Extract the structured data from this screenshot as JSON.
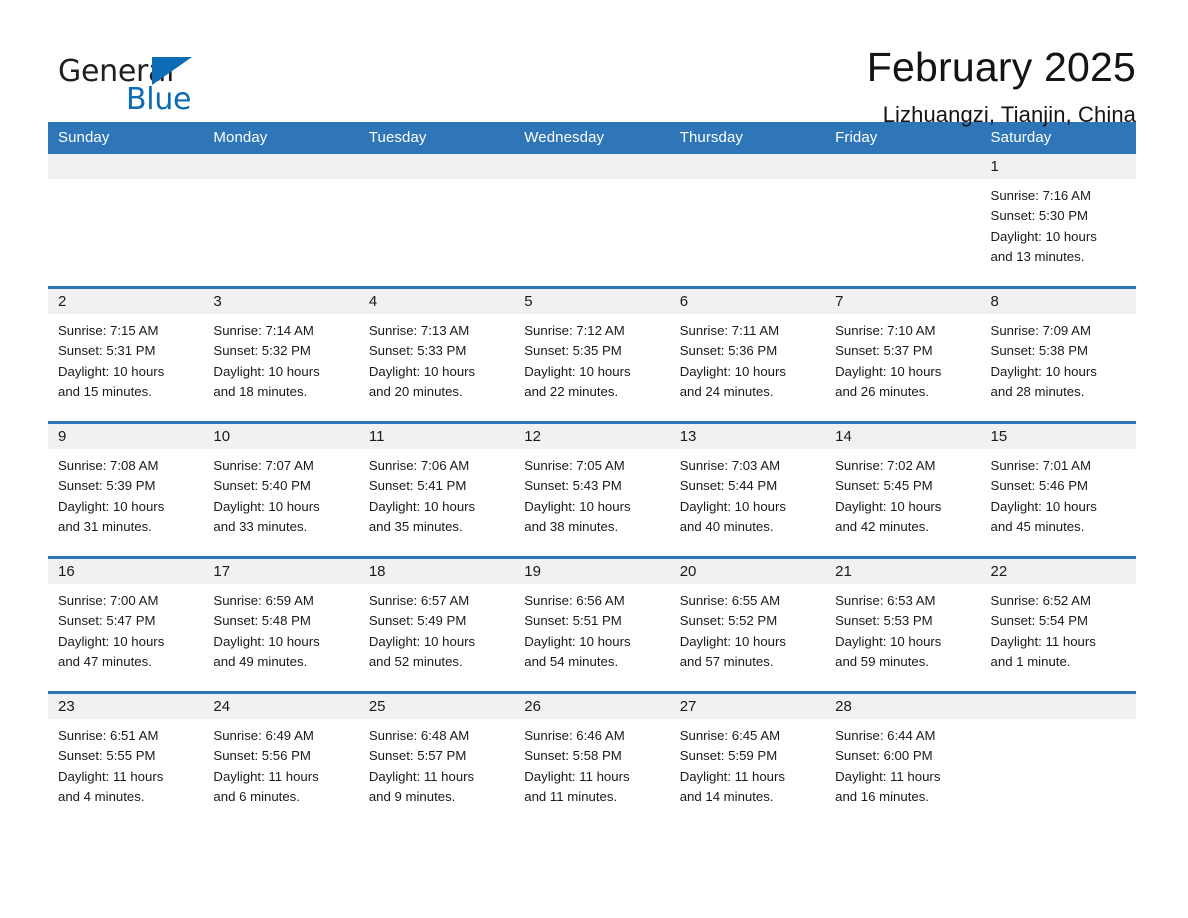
{
  "logo": {
    "word_one": "General",
    "word_two": "Blue",
    "triangle_color": "#0c6cb5"
  },
  "header": {
    "month_title": "February 2025",
    "location": "Lizhuangzi, Tianjin, China"
  },
  "theme": {
    "header_blue": "#2f76b8",
    "daynum_gray": "#f1f1f1",
    "text": "#1a1a1a"
  },
  "calendar": {
    "weekday_headers": [
      "Sunday",
      "Monday",
      "Tuesday",
      "Wednesday",
      "Thursday",
      "Friday",
      "Saturday"
    ],
    "labels": {
      "sunrise": "Sunrise:",
      "sunset": "Sunset:",
      "daylight": "Daylight:"
    },
    "weeks": [
      [
        {
          "day": "",
          "sunrise": "",
          "sunset": "",
          "daylight_line1": "",
          "daylight_line2": "",
          "empty": true
        },
        {
          "day": "",
          "sunrise": "",
          "sunset": "",
          "daylight_line1": "",
          "daylight_line2": "",
          "empty": true
        },
        {
          "day": "",
          "sunrise": "",
          "sunset": "",
          "daylight_line1": "",
          "daylight_line2": "",
          "empty": true
        },
        {
          "day": "",
          "sunrise": "",
          "sunset": "",
          "daylight_line1": "",
          "daylight_line2": "",
          "empty": true
        },
        {
          "day": "",
          "sunrise": "",
          "sunset": "",
          "daylight_line1": "",
          "daylight_line2": "",
          "empty": true
        },
        {
          "day": "",
          "sunrise": "",
          "sunset": "",
          "daylight_line1": "",
          "daylight_line2": "",
          "empty": true
        },
        {
          "day": "1",
          "sunrise": "Sunrise: 7:16 AM",
          "sunset": "Sunset: 5:30 PM",
          "daylight_line1": "Daylight: 10 hours",
          "daylight_line2": "and 13 minutes.",
          "empty": false
        }
      ],
      [
        {
          "day": "2",
          "sunrise": "Sunrise: 7:15 AM",
          "sunset": "Sunset: 5:31 PM",
          "daylight_line1": "Daylight: 10 hours",
          "daylight_line2": "and 15 minutes.",
          "empty": false
        },
        {
          "day": "3",
          "sunrise": "Sunrise: 7:14 AM",
          "sunset": "Sunset: 5:32 PM",
          "daylight_line1": "Daylight: 10 hours",
          "daylight_line2": "and 18 minutes.",
          "empty": false
        },
        {
          "day": "4",
          "sunrise": "Sunrise: 7:13 AM",
          "sunset": "Sunset: 5:33 PM",
          "daylight_line1": "Daylight: 10 hours",
          "daylight_line2": "and 20 minutes.",
          "empty": false
        },
        {
          "day": "5",
          "sunrise": "Sunrise: 7:12 AM",
          "sunset": "Sunset: 5:35 PM",
          "daylight_line1": "Daylight: 10 hours",
          "daylight_line2": "and 22 minutes.",
          "empty": false
        },
        {
          "day": "6",
          "sunrise": "Sunrise: 7:11 AM",
          "sunset": "Sunset: 5:36 PM",
          "daylight_line1": "Daylight: 10 hours",
          "daylight_line2": "and 24 minutes.",
          "empty": false
        },
        {
          "day": "7",
          "sunrise": "Sunrise: 7:10 AM",
          "sunset": "Sunset: 5:37 PM",
          "daylight_line1": "Daylight: 10 hours",
          "daylight_line2": "and 26 minutes.",
          "empty": false
        },
        {
          "day": "8",
          "sunrise": "Sunrise: 7:09 AM",
          "sunset": "Sunset: 5:38 PM",
          "daylight_line1": "Daylight: 10 hours",
          "daylight_line2": "and 28 minutes.",
          "empty": false
        }
      ],
      [
        {
          "day": "9",
          "sunrise": "Sunrise: 7:08 AM",
          "sunset": "Sunset: 5:39 PM",
          "daylight_line1": "Daylight: 10 hours",
          "daylight_line2": "and 31 minutes.",
          "empty": false
        },
        {
          "day": "10",
          "sunrise": "Sunrise: 7:07 AM",
          "sunset": "Sunset: 5:40 PM",
          "daylight_line1": "Daylight: 10 hours",
          "daylight_line2": "and 33 minutes.",
          "empty": false
        },
        {
          "day": "11",
          "sunrise": "Sunrise: 7:06 AM",
          "sunset": "Sunset: 5:41 PM",
          "daylight_line1": "Daylight: 10 hours",
          "daylight_line2": "and 35 minutes.",
          "empty": false
        },
        {
          "day": "12",
          "sunrise": "Sunrise: 7:05 AM",
          "sunset": "Sunset: 5:43 PM",
          "daylight_line1": "Daylight: 10 hours",
          "daylight_line2": "and 38 minutes.",
          "empty": false
        },
        {
          "day": "13",
          "sunrise": "Sunrise: 7:03 AM",
          "sunset": "Sunset: 5:44 PM",
          "daylight_line1": "Daylight: 10 hours",
          "daylight_line2": "and 40 minutes.",
          "empty": false
        },
        {
          "day": "14",
          "sunrise": "Sunrise: 7:02 AM",
          "sunset": "Sunset: 5:45 PM",
          "daylight_line1": "Daylight: 10 hours",
          "daylight_line2": "and 42 minutes.",
          "empty": false
        },
        {
          "day": "15",
          "sunrise": "Sunrise: 7:01 AM",
          "sunset": "Sunset: 5:46 PM",
          "daylight_line1": "Daylight: 10 hours",
          "daylight_line2": "and 45 minutes.",
          "empty": false
        }
      ],
      [
        {
          "day": "16",
          "sunrise": "Sunrise: 7:00 AM",
          "sunset": "Sunset: 5:47 PM",
          "daylight_line1": "Daylight: 10 hours",
          "daylight_line2": "and 47 minutes.",
          "empty": false
        },
        {
          "day": "17",
          "sunrise": "Sunrise: 6:59 AM",
          "sunset": "Sunset: 5:48 PM",
          "daylight_line1": "Daylight: 10 hours",
          "daylight_line2": "and 49 minutes.",
          "empty": false
        },
        {
          "day": "18",
          "sunrise": "Sunrise: 6:57 AM",
          "sunset": "Sunset: 5:49 PM",
          "daylight_line1": "Daylight: 10 hours",
          "daylight_line2": "and 52 minutes.",
          "empty": false
        },
        {
          "day": "19",
          "sunrise": "Sunrise: 6:56 AM",
          "sunset": "Sunset: 5:51 PM",
          "daylight_line1": "Daylight: 10 hours",
          "daylight_line2": "and 54 minutes.",
          "empty": false
        },
        {
          "day": "20",
          "sunrise": "Sunrise: 6:55 AM",
          "sunset": "Sunset: 5:52 PM",
          "daylight_line1": "Daylight: 10 hours",
          "daylight_line2": "and 57 minutes.",
          "empty": false
        },
        {
          "day": "21",
          "sunrise": "Sunrise: 6:53 AM",
          "sunset": "Sunset: 5:53 PM",
          "daylight_line1": "Daylight: 10 hours",
          "daylight_line2": "and 59 minutes.",
          "empty": false
        },
        {
          "day": "22",
          "sunrise": "Sunrise: 6:52 AM",
          "sunset": "Sunset: 5:54 PM",
          "daylight_line1": "Daylight: 11 hours",
          "daylight_line2": "and 1 minute.",
          "empty": false
        }
      ],
      [
        {
          "day": "23",
          "sunrise": "Sunrise: 6:51 AM",
          "sunset": "Sunset: 5:55 PM",
          "daylight_line1": "Daylight: 11 hours",
          "daylight_line2": "and 4 minutes.",
          "empty": false
        },
        {
          "day": "24",
          "sunrise": "Sunrise: 6:49 AM",
          "sunset": "Sunset: 5:56 PM",
          "daylight_line1": "Daylight: 11 hours",
          "daylight_line2": "and 6 minutes.",
          "empty": false
        },
        {
          "day": "25",
          "sunrise": "Sunrise: 6:48 AM",
          "sunset": "Sunset: 5:57 PM",
          "daylight_line1": "Daylight: 11 hours",
          "daylight_line2": "and 9 minutes.",
          "empty": false
        },
        {
          "day": "26",
          "sunrise": "Sunrise: 6:46 AM",
          "sunset": "Sunset: 5:58 PM",
          "daylight_line1": "Daylight: 11 hours",
          "daylight_line2": "and 11 minutes.",
          "empty": false
        },
        {
          "day": "27",
          "sunrise": "Sunrise: 6:45 AM",
          "sunset": "Sunset: 5:59 PM",
          "daylight_line1": "Daylight: 11 hours",
          "daylight_line2": "and 14 minutes.",
          "empty": false
        },
        {
          "day": "28",
          "sunrise": "Sunrise: 6:44 AM",
          "sunset": "Sunset: 6:00 PM",
          "daylight_line1": "Daylight: 11 hours",
          "daylight_line2": "and 16 minutes.",
          "empty": false
        },
        {
          "day": "",
          "sunrise": "",
          "sunset": "",
          "daylight_line1": "",
          "daylight_line2": "",
          "empty": true
        }
      ]
    ]
  }
}
